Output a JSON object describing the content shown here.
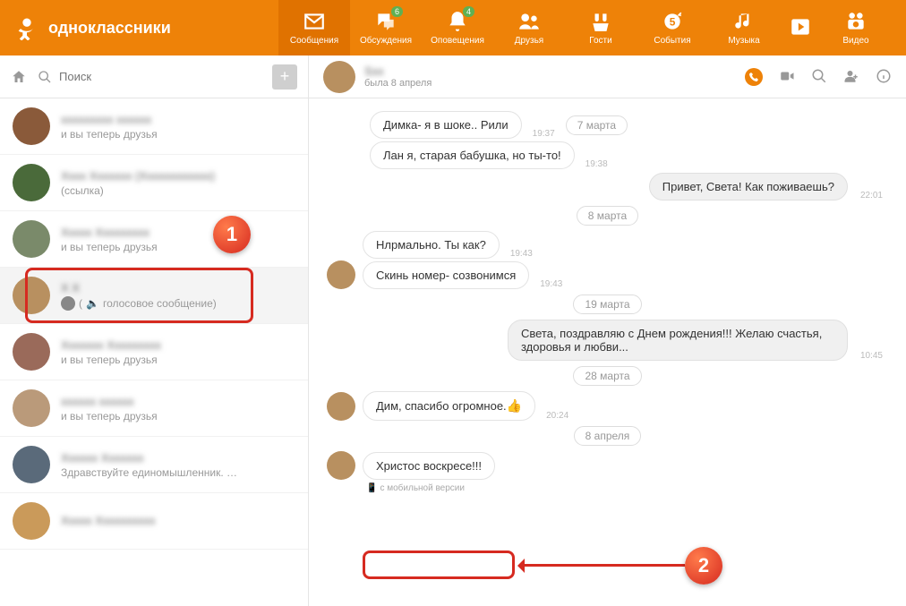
{
  "header": {
    "brand": "одноклассники",
    "nav": [
      {
        "label": "Сообщения",
        "active": true
      },
      {
        "label": "Обсуждения",
        "badge": "6"
      },
      {
        "label": "Оповещения",
        "badge": "4"
      },
      {
        "label": "Друзья"
      },
      {
        "label": "Гости"
      },
      {
        "label": "События"
      },
      {
        "label": "Музыка"
      },
      {
        "label": "Видео"
      }
    ]
  },
  "sidebar": {
    "search_placeholder": "Поиск",
    "items": [
      {
        "sub": "и вы теперь друзья"
      },
      {
        "sub": "(ссылка)"
      },
      {
        "sub": "и вы теперь друзья"
      },
      {
        "voice_label": "голосовое сообщение)"
      },
      {
        "sub": "и вы теперь друзья"
      },
      {
        "sub": "и вы теперь друзья"
      },
      {
        "sub": "Здравствуйте единомышленник. …"
      },
      {
        "sub": ""
      }
    ]
  },
  "chat": {
    "head_name_prefix": "S",
    "status": "была 8 апреля",
    "date1": "7 марта",
    "date2": "8 марта",
    "date3": "19 марта",
    "date4": "28 марта",
    "date5": "8 апреля",
    "m1": {
      "text": "Димка- я в шоке.. Рили",
      "time": "19:37"
    },
    "m2": {
      "text": "Лан я, старая бабушка, но ты-то!",
      "time": "19:38"
    },
    "m3": {
      "text": "Привет, Света! Как поживаешь?",
      "time": "22:01"
    },
    "m4": {
      "text": "Нлрмально. Ты как?",
      "time": "19:43"
    },
    "m5": {
      "text": "Скинь номер- созвонимся",
      "time": "19:43"
    },
    "m6": {
      "text": "Света, поздравляю с Днем рождения!!! Желаю счастья, здоровья и любви...",
      "time": "10:45"
    },
    "m7": {
      "text": "Дим, спасибо огромное.",
      "time": "20:24"
    },
    "m8": {
      "text": "Христос воскресе!!!"
    },
    "mobile_note": "с мобильной версии"
  },
  "annotations": {
    "step1": "1",
    "step2": "2"
  }
}
